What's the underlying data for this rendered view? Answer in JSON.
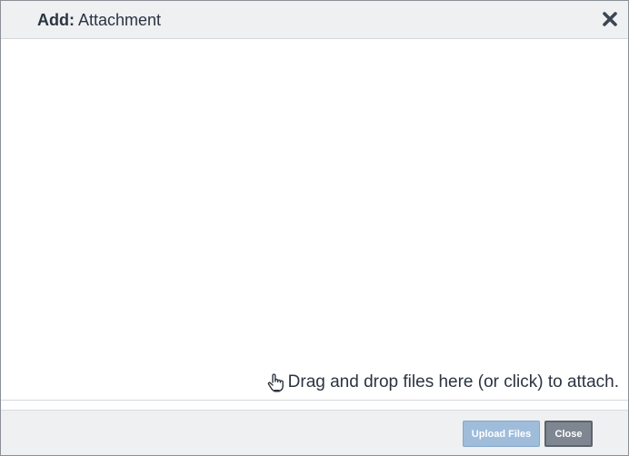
{
  "dialog": {
    "title_prefix": "Add:",
    "title_name": "Attachment",
    "close_icon": "close-x-icon"
  },
  "dropzone": {
    "hint": "Drag and drop files here (or click) to attach.",
    "icon": "pointing-hand-icon"
  },
  "footer": {
    "upload_label": "Upload Files",
    "close_label": "Close"
  },
  "colors": {
    "header_bg": "#eef0f2",
    "footer_bg": "#eef0f2",
    "upload_button": "#9fbddb",
    "close_button": "#7e8791",
    "text": "#2b3441"
  }
}
